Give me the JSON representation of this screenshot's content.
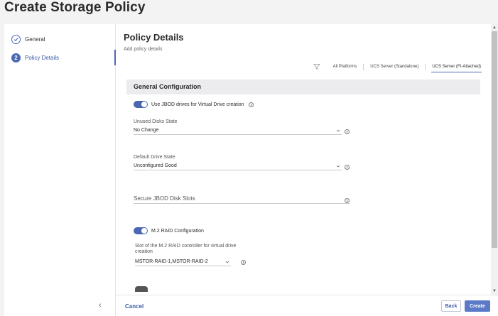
{
  "page": {
    "title": "Create Storage Policy"
  },
  "steps": [
    {
      "number": "",
      "label": "General",
      "state": "done"
    },
    {
      "number": "2",
      "label": "Policy Details",
      "state": "active"
    }
  ],
  "content": {
    "title": "Policy Details",
    "subtitle": "Add policy details",
    "platforms": [
      "All Platforms",
      "UCS Server (Standalone)",
      "UCS Server (FI-Attached)"
    ],
    "selected_platform": "UCS Server (FI-Attached)"
  },
  "general_config": {
    "heading": "General Configuration",
    "jbod_toggle": {
      "label": "Use JBOD drives for Virtual Drive creation",
      "on": true
    },
    "unused_disks": {
      "label": "Unused Disks State",
      "value": "No Change"
    },
    "default_drive": {
      "label": "Default Drive State",
      "value": "Unconfigured Good"
    },
    "secure_jbod": {
      "placeholder": "Secure JBOD Disk Slots"
    },
    "m2_toggle": {
      "label": "M.2 RAID Configuration",
      "on": true
    },
    "m2_slot": {
      "label": "Slot of the M.2 RAID controller for virtual drive creation",
      "value": "MSTOR-RAID-1,MSTOR-RAID-2"
    }
  },
  "footer": {
    "cancel": "Cancel",
    "back": "Back",
    "create": "Create"
  },
  "colors": {
    "accent": "#4a68b1",
    "primary_button": "#5a79c7"
  }
}
